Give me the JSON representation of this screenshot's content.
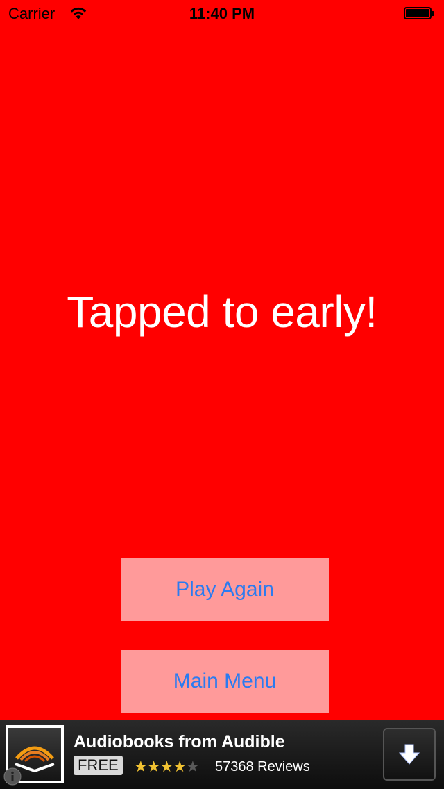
{
  "status_bar": {
    "carrier": "Carrier",
    "time": "11:40 PM"
  },
  "main": {
    "message": "Tapped to early!",
    "background_color": "#ff0000"
  },
  "buttons": {
    "play_again": "Play Again",
    "main_menu": "Main Menu"
  },
  "ad": {
    "title": "Audiobooks from Audible",
    "price": "FREE",
    "rating": 4,
    "rating_max": 5,
    "reviews": "57368 Reviews",
    "icons": {
      "app": "audible-logo-icon",
      "download": "download-arrow-icon",
      "info": "info-icon"
    }
  }
}
